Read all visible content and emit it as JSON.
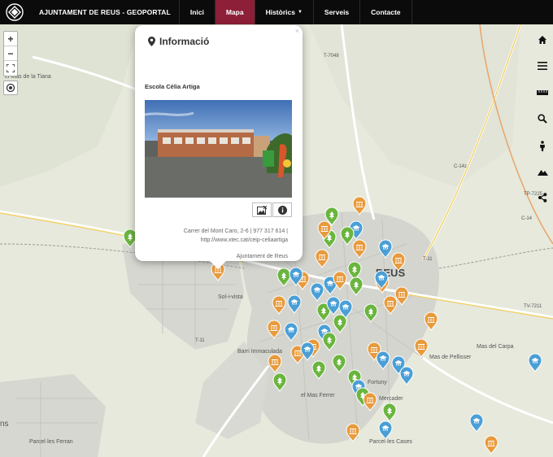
{
  "navbar": {
    "brand": "AJUNTAMENT DE REUS - GEOPORTAL",
    "items": [
      {
        "label": "Inici"
      },
      {
        "label": "Mapa"
      },
      {
        "label": "Històrics"
      },
      {
        "label": "Serveis"
      },
      {
        "label": "Contacte"
      }
    ],
    "active_item": "Mapa"
  },
  "map": {
    "zoom_in_label": "+",
    "zoom_out_label": "−",
    "place_labels": [
      "el Mas de la Tiana",
      "REUS",
      "Sol-i-vista",
      "Barri Immaculada",
      "Mas de Pellisser",
      "Mas del Carpa",
      "Fortuny",
      "el Mas Ferrer",
      "Mercader",
      "Parcel·les Ferran",
      "Parcel·les Cases",
      "ns"
    ],
    "road_labels": [
      "T-7048",
      "C-14z",
      "TP-7225",
      "C-14",
      "T-11",
      "TV-7211",
      "T-11"
    ],
    "marker_colors": {
      "education": "#4a9fd6",
      "culture": "#e89a3c",
      "nature": "#6ab53e"
    }
  },
  "popup": {
    "title": "Informació",
    "close_label": "×",
    "school_name": "Escola Cèlia Artiga",
    "address_line1": "Carrer del Mont Caro, 2-6 | 977 317 614 |",
    "address_line2": "http://www.xtec.cat/ceip-celiaartiga",
    "owner": "Ajuntament de Reus"
  },
  "right_tools": [
    "home-icon",
    "menu-icon",
    "measure-icon",
    "search-icon",
    "streetview-icon",
    "terrain-icon",
    "share-icon"
  ]
}
